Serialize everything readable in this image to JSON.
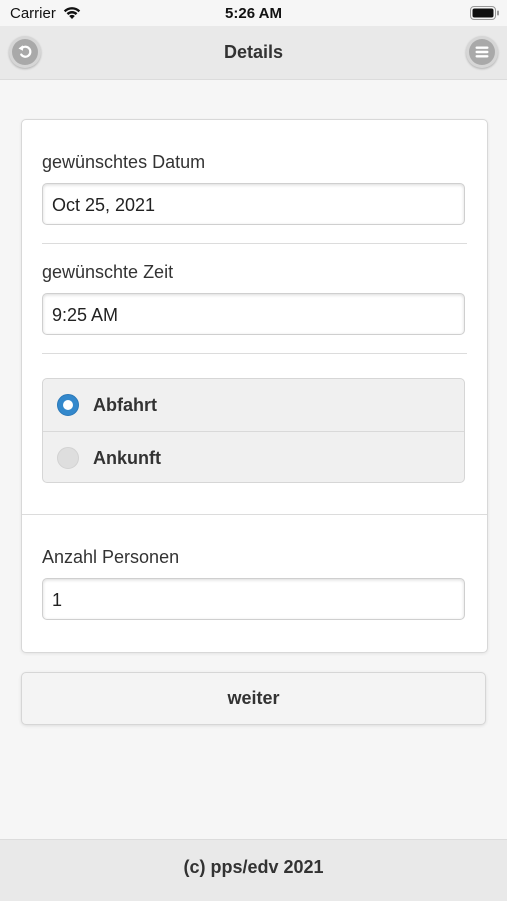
{
  "status_bar": {
    "carrier": "Carrier",
    "time": "5:26 AM",
    "icons": [
      "wifi-icon",
      "battery-icon"
    ]
  },
  "header": {
    "title": "Details",
    "back_icon": "back-arrow-icon",
    "menu_icon": "menu-icon"
  },
  "form": {
    "date": {
      "label": "gewünschtes Datum",
      "value": "Oct 25, 2021"
    },
    "time": {
      "label": "gewünschte Zeit",
      "value": "9:25 AM"
    },
    "direction": {
      "options": [
        {
          "label": "Abfahrt",
          "selected": true
        },
        {
          "label": "Ankunft",
          "selected": false
        }
      ]
    },
    "persons": {
      "label": "Anzahl Personen",
      "value": "1"
    }
  },
  "next_button": {
    "label": "weiter"
  },
  "footer": {
    "text": "(c) pps/edv 2021"
  },
  "colors": {
    "accent": "#3388cc",
    "header_bg": "#e9e9e9",
    "page_bg": "#f6f6f6"
  }
}
